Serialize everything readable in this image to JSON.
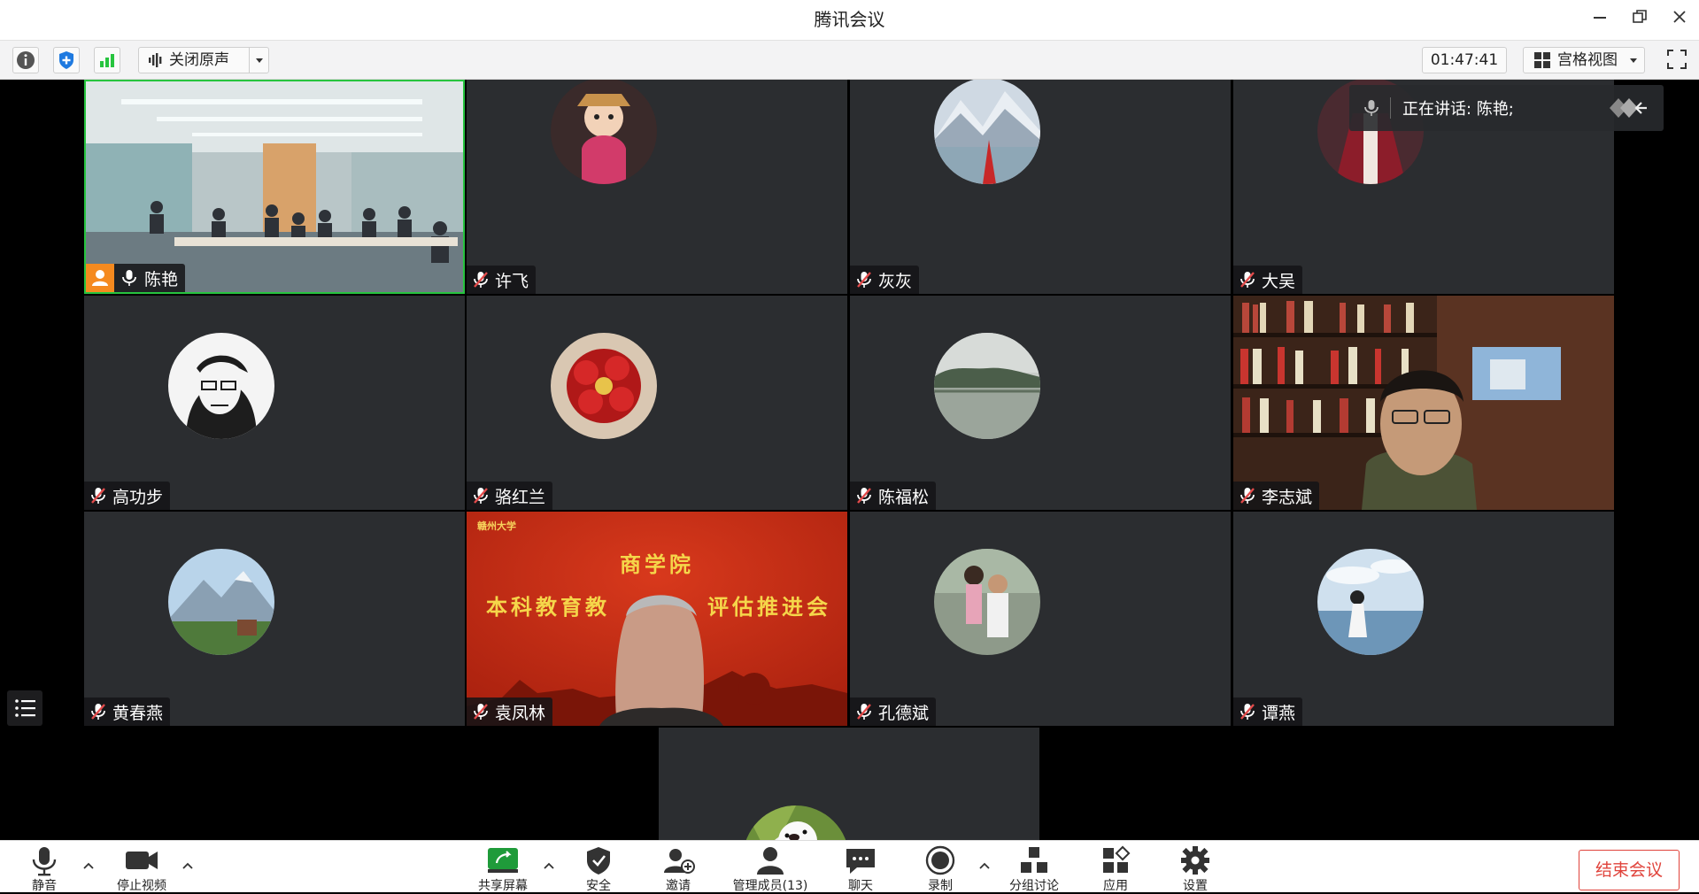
{
  "window": {
    "title": "腾讯会议"
  },
  "toolbar": {
    "audio_toggle_label": "关闭原声",
    "timer": "01:47:41",
    "view_mode_label": "宫格视图"
  },
  "speaking_indicator": {
    "text": "正在讲话: 陈艳;"
  },
  "participants": [
    {
      "name": "陈艳"
    },
    {
      "name": "许飞"
    },
    {
      "name": "灰灰"
    },
    {
      "name": "大吴"
    },
    {
      "name": "高功步"
    },
    {
      "name": "骆红兰"
    },
    {
      "name": "陈福松"
    },
    {
      "name": "李志斌"
    },
    {
      "name": "黄春燕"
    },
    {
      "name": "袁凤林"
    },
    {
      "name": "孔德斌"
    },
    {
      "name": "谭燕"
    }
  ],
  "slide": {
    "logo_text": "赣州大学",
    "line1": "商学院",
    "line2_left": "本科教育教",
    "line2_right": "评估推进会"
  },
  "bottom_bar": {
    "mute": "静音",
    "stop_video": "停止视频",
    "share_screen": "共享屏幕",
    "security": "安全",
    "invite": "邀请",
    "manage_members": "管理成员(13)",
    "chat": "聊天",
    "record": "录制",
    "breakout": "分组讨论",
    "apps": "应用",
    "settings": "设置",
    "end_meeting": "结束会议"
  },
  "colors": {
    "accent_green": "#27c43f",
    "shield_blue": "#1f7ae0",
    "end_red": "#e0433b",
    "tile_bg": "#2b2d30",
    "host_orange": "#f58a1f"
  }
}
